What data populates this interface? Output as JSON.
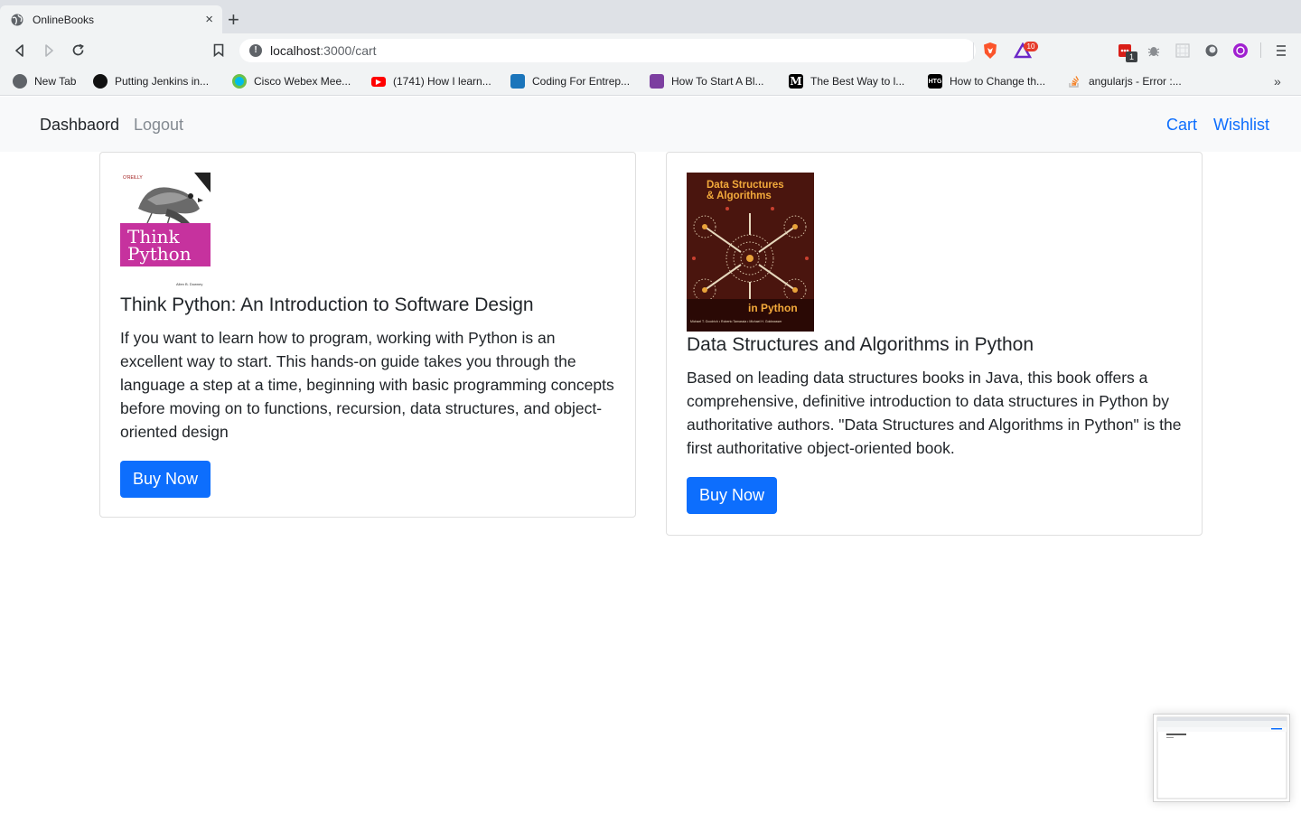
{
  "browser": {
    "tab_title": "OnlineBooks",
    "tab_close": "×",
    "new_tab": "+",
    "url_host": "localhost",
    "url_path": ":3000/cart",
    "extension_badge": "10",
    "ext_counter": "1"
  },
  "bookmarks": [
    {
      "label": "New Tab",
      "icon": "globe-icon"
    },
    {
      "label": "Putting Jenkins in...",
      "icon": "jenkins-icon"
    },
    {
      "label": "Cisco Webex Mee...",
      "icon": "webex-icon"
    },
    {
      "label": "(1741) How I learn...",
      "icon": "youtube-icon"
    },
    {
      "label": "Coding For Entrep...",
      "icon": "bookmark-site-icon"
    },
    {
      "label": "How To Start A Bl...",
      "icon": "colorlib-icon"
    },
    {
      "label": "The Best Way to l...",
      "icon": "medium-icon"
    },
    {
      "label": "How to Change th...",
      "icon": "htg-icon"
    },
    {
      "label": "angularjs - Error :...",
      "icon": "stackoverflow-icon"
    }
  ],
  "navbar": {
    "brand": "Dashbaord",
    "logout": "Logout",
    "cart": "Cart",
    "wishlist": "Wishlist"
  },
  "books": [
    {
      "title": "Think Python: An Introduction to Software Design",
      "description": "If you want to learn how to program, working with Python is an excellent way to start. This hands-on guide takes you through the language a step at a time, beginning with basic programming concepts before moving on to functions, recursion, data structures, and object-oriented design",
      "button": "Buy Now",
      "cover": {
        "title_line1": "Think",
        "title_line2": "Python",
        "publisher": "O'REILLY",
        "author": "Allen B. Downey"
      }
    },
    {
      "title": "Data Structures and Algorithms in Python",
      "description": "Based on leading data structures books in Java, this book offers a comprehensive, definitive introduction to data structures in Python by authoritative authors. \"Data Structures and Algorithms in Python\" is the first authoritative object-oriented book.",
      "button": "Buy Now",
      "cover": {
        "title_line1": "Data Structures",
        "title_line2": "& Algorithms",
        "subtitle": "in Python",
        "authors": "Michael T. Goodrich • Roberto Tamassia • Michael H. Goldwasser"
      }
    }
  ],
  "colors": {
    "primary": "#0d6efd",
    "navbar_bg": "#f8f9fa"
  }
}
